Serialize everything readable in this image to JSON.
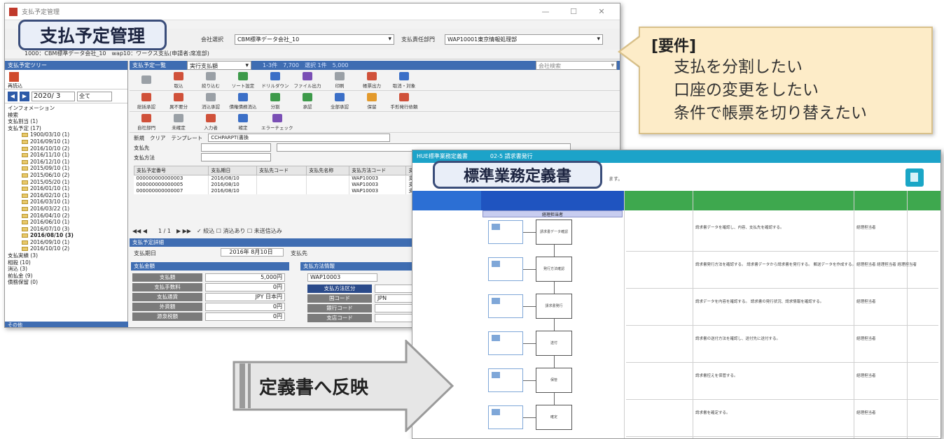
{
  "window": {
    "title": "支払予定管理",
    "bubble_title": "支払予定管理",
    "controls": [
      "—",
      "☐",
      "✕"
    ]
  },
  "topbar": {
    "company_label": "会社選択",
    "company_value": "CBM標準データ会社_10",
    "dept_label": "支払責任部門",
    "dept_value": "WAP10001東京情報処理部"
  },
  "infobar": "1000：CBM標準データ会社_10　wap10：ワークス支払(申請者:席准部)",
  "left": {
    "header": "支払予定ツリー",
    "pay_icon_label": "再読込",
    "year": "2020/ 3",
    "filter": "全て",
    "tree": [
      {
        "text": "インフォメーション",
        "bold": false,
        "folder": false
      },
      {
        "text": "検索",
        "bold": false,
        "folder": false
      },
      {
        "text": "支払割当 (1)",
        "bold": false,
        "folder": false
      },
      {
        "text": "支払予定 (17)",
        "bold": false,
        "folder": false
      },
      {
        "text": "1900/03/10 (1)",
        "bold": false,
        "folder": true
      },
      {
        "text": "2016/09/10 (1)",
        "bold": false,
        "folder": true
      },
      {
        "text": "2016/10/10 (2)",
        "bold": false,
        "folder": true
      },
      {
        "text": "2016/11/10 (1)",
        "bold": false,
        "folder": true
      },
      {
        "text": "2016/12/10 (1)",
        "bold": false,
        "folder": true
      },
      {
        "text": "2015/09/10 (1)",
        "bold": false,
        "folder": true
      },
      {
        "text": "2015/06/10 (2)",
        "bold": false,
        "folder": true
      },
      {
        "text": "2015/05/20 (1)",
        "bold": false,
        "folder": true
      },
      {
        "text": "2016/01/10 (1)",
        "bold": false,
        "folder": true
      },
      {
        "text": "2016/02/10 (1)",
        "bold": false,
        "folder": true
      },
      {
        "text": "2016/03/10 (1)",
        "bold": false,
        "folder": true
      },
      {
        "text": "2016/03/22 (1)",
        "bold": false,
        "folder": true
      },
      {
        "text": "2016/04/10 (2)",
        "bold": false,
        "folder": true
      },
      {
        "text": "2016/06/10 (1)",
        "bold": false,
        "folder": true
      },
      {
        "text": "2016/07/10 (3)",
        "bold": false,
        "folder": true
      },
      {
        "text": "2016/08/10 (3)",
        "bold": true,
        "folder": true
      },
      {
        "text": "2016/09/10 (1)",
        "bold": false,
        "folder": true
      },
      {
        "text": "2016/10/10 (2)",
        "bold": false,
        "folder": true
      },
      {
        "text": "支払実績 (3)",
        "bold": false,
        "folder": false
      },
      {
        "text": "相殺 (10)",
        "bold": false,
        "folder": false
      },
      {
        "text": "消込 (3)",
        "bold": false,
        "folder": false
      },
      {
        "text": "前払金 (9)",
        "bold": false,
        "folder": false
      },
      {
        "text": "債務保留 (0)",
        "bold": false,
        "folder": false
      }
    ],
    "status": "その他"
  },
  "right": {
    "list_title": "支払予定一覧",
    "list_combo": "実行支払額",
    "list_info": "1-3件　7,700　選択 1件　5,000",
    "search_placeholder": "会社検索",
    "toolbar1": [
      {
        "label": "",
        "color": "gray"
      },
      {
        "label": "取込",
        "color": "red"
      },
      {
        "label": "絞り込む",
        "color": "gray"
      },
      {
        "label": "ソート設定",
        "color": "green"
      },
      {
        "label": "ドリルダウン",
        "color": "blue"
      },
      {
        "label": "ファイル出力",
        "color": "purple"
      },
      {
        "label": "印刷",
        "color": "gray"
      },
      {
        "label": "帳票出力",
        "color": "red"
      },
      {
        "label": "取消・対象",
        "color": "blue"
      }
    ],
    "toolbar2": [
      {
        "label": "総括承認",
        "color": "red"
      },
      {
        "label": "異不要分",
        "color": "red"
      },
      {
        "label": "消込承認",
        "color": "gray"
      },
      {
        "label": "債権債務消込",
        "color": "blue"
      },
      {
        "label": "分割",
        "color": "green"
      },
      {
        "label": "承認",
        "color": "green"
      },
      {
        "label": "全部承認",
        "color": "blue"
      },
      {
        "label": "保留",
        "color": "orange"
      },
      {
        "label": "手形発行依頼",
        "color": "red"
      }
    ],
    "toolbar3": [
      {
        "label": "自社部門",
        "color": "red"
      },
      {
        "label": "未確定",
        "color": "gray"
      },
      {
        "label": "入力者",
        "color": "red"
      },
      {
        "label": "確定",
        "color": "blue"
      },
      {
        "label": "エラーチェック",
        "color": "purple"
      }
    ],
    "form": {
      "new": "新規",
      "clear": "クリア",
      "template": "テンプレート",
      "template_value": "CCHPARPT(書換",
      "payee_label": "支払先",
      "method_label": "支払方法"
    },
    "table": {
      "headers": [
        "支払予定番号",
        "支払期日",
        "支払先コード",
        "支払先名称",
        "支払方法コード",
        "支払"
      ],
      "rows": [
        [
          "000000000000003",
          "2016/08/10",
          "",
          "",
          "WAP10003",
          "支払"
        ],
        [
          "000000000000005",
          "2016/08/10",
          "",
          "",
          "WAP10003",
          "支払"
        ],
        [
          "000000000000007",
          "2016/08/10",
          "",
          "",
          "WAP10003",
          "支払"
        ]
      ]
    },
    "nav": "◀◀ ◀　　1 / 1　▶ ▶▶　✓ 絞込 ☐ 消込あり ☐ 未送信込み",
    "detail": {
      "header": "支払予定詳細",
      "due_label": "支払期日",
      "due_value": "2016年 8月10日",
      "payee_label": "支払先",
      "amount_section": "支払金額",
      "amount_rows": [
        {
          "label": "支払額",
          "value": "5,000円"
        },
        {
          "label": "支払手数料",
          "value": "0円"
        },
        {
          "label": "支払通貨",
          "value": "JPY 日本円"
        },
        {
          "label": "外貨額",
          "value": "0円"
        },
        {
          "label": "源泉税額",
          "value": "0円"
        }
      ],
      "method_section": "支払方法情報",
      "method_value": "WAP10003",
      "method_rows": [
        {
          "label": "支払方法区分",
          "value": ""
        },
        {
          "label": "国コード",
          "value": "JPN"
        },
        {
          "label": "銀行コード",
          "value": ""
        },
        {
          "label": "支店コード",
          "value": ""
        }
      ]
    }
  },
  "note": {
    "title": "[要件]",
    "items": [
      "支払を分割したい",
      "口座の変更をしたい",
      "条件で帳票を切り替えたい"
    ]
  },
  "doc": {
    "header": "HUE標準業務定義書　　　　02-5 請求書発行",
    "bubble_title": "標準業務定義書",
    "sub_note": "ます。",
    "swimlane_label": "経理担当者",
    "steps": [
      {
        "text": "請求書データを確認し、内容、支払先を確認する。",
        "actor": "経理担当者"
      },
      {
        "text": "請求書発行方法を確認する。  請求書データから請求書を発行する。  郵送データを作成する。",
        "actor": "経理担当者 経理担当者 経理担当者"
      },
      {
        "text": "請求データを内容を確認する。  請求書の発行状況、請求情報を確認する。",
        "actor": "経理担当者"
      },
      {
        "text": "請求書の送付方法を確認し、送付先に送付する。",
        "actor": "経理担当者"
      },
      {
        "text": "請求書控えを保管する。",
        "actor": "経理担当者"
      },
      {
        "text": "請求書を確定する。",
        "actor": "経理担当者"
      }
    ],
    "flow_labels": [
      "請求書データ確認",
      "発行方法確認",
      "請求書発行",
      "送付",
      "保管",
      "確定"
    ]
  },
  "arrow": {
    "text": "定義書へ反映"
  }
}
